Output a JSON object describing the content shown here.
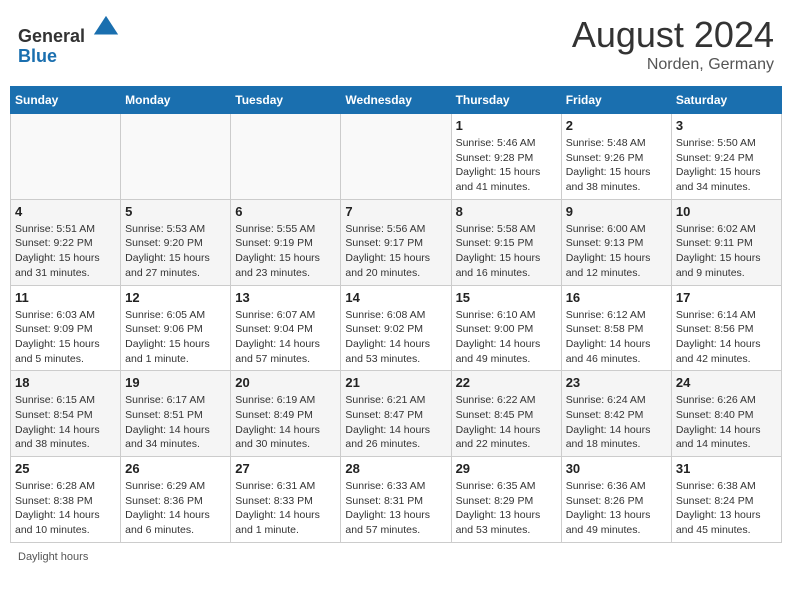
{
  "header": {
    "logo_line1": "General",
    "logo_line2": "Blue",
    "month_title": "August 2024",
    "location": "Norden, Germany"
  },
  "days_of_week": [
    "Sunday",
    "Monday",
    "Tuesday",
    "Wednesday",
    "Thursday",
    "Friday",
    "Saturday"
  ],
  "footer": {
    "note": "Daylight hours"
  },
  "weeks": [
    [
      {
        "day": "",
        "info": ""
      },
      {
        "day": "",
        "info": ""
      },
      {
        "day": "",
        "info": ""
      },
      {
        "day": "",
        "info": ""
      },
      {
        "day": "1",
        "info": "Sunrise: 5:46 AM\nSunset: 9:28 PM\nDaylight: 15 hours\nand 41 minutes."
      },
      {
        "day": "2",
        "info": "Sunrise: 5:48 AM\nSunset: 9:26 PM\nDaylight: 15 hours\nand 38 minutes."
      },
      {
        "day": "3",
        "info": "Sunrise: 5:50 AM\nSunset: 9:24 PM\nDaylight: 15 hours\nand 34 minutes."
      }
    ],
    [
      {
        "day": "4",
        "info": "Sunrise: 5:51 AM\nSunset: 9:22 PM\nDaylight: 15 hours\nand 31 minutes."
      },
      {
        "day": "5",
        "info": "Sunrise: 5:53 AM\nSunset: 9:20 PM\nDaylight: 15 hours\nand 27 minutes."
      },
      {
        "day": "6",
        "info": "Sunrise: 5:55 AM\nSunset: 9:19 PM\nDaylight: 15 hours\nand 23 minutes."
      },
      {
        "day": "7",
        "info": "Sunrise: 5:56 AM\nSunset: 9:17 PM\nDaylight: 15 hours\nand 20 minutes."
      },
      {
        "day": "8",
        "info": "Sunrise: 5:58 AM\nSunset: 9:15 PM\nDaylight: 15 hours\nand 16 minutes."
      },
      {
        "day": "9",
        "info": "Sunrise: 6:00 AM\nSunset: 9:13 PM\nDaylight: 15 hours\nand 12 minutes."
      },
      {
        "day": "10",
        "info": "Sunrise: 6:02 AM\nSunset: 9:11 PM\nDaylight: 15 hours\nand 9 minutes."
      }
    ],
    [
      {
        "day": "11",
        "info": "Sunrise: 6:03 AM\nSunset: 9:09 PM\nDaylight: 15 hours\nand 5 minutes."
      },
      {
        "day": "12",
        "info": "Sunrise: 6:05 AM\nSunset: 9:06 PM\nDaylight: 15 hours\nand 1 minute."
      },
      {
        "day": "13",
        "info": "Sunrise: 6:07 AM\nSunset: 9:04 PM\nDaylight: 14 hours\nand 57 minutes."
      },
      {
        "day": "14",
        "info": "Sunrise: 6:08 AM\nSunset: 9:02 PM\nDaylight: 14 hours\nand 53 minutes."
      },
      {
        "day": "15",
        "info": "Sunrise: 6:10 AM\nSunset: 9:00 PM\nDaylight: 14 hours\nand 49 minutes."
      },
      {
        "day": "16",
        "info": "Sunrise: 6:12 AM\nSunset: 8:58 PM\nDaylight: 14 hours\nand 46 minutes."
      },
      {
        "day": "17",
        "info": "Sunrise: 6:14 AM\nSunset: 8:56 PM\nDaylight: 14 hours\nand 42 minutes."
      }
    ],
    [
      {
        "day": "18",
        "info": "Sunrise: 6:15 AM\nSunset: 8:54 PM\nDaylight: 14 hours\nand 38 minutes."
      },
      {
        "day": "19",
        "info": "Sunrise: 6:17 AM\nSunset: 8:51 PM\nDaylight: 14 hours\nand 34 minutes."
      },
      {
        "day": "20",
        "info": "Sunrise: 6:19 AM\nSunset: 8:49 PM\nDaylight: 14 hours\nand 30 minutes."
      },
      {
        "day": "21",
        "info": "Sunrise: 6:21 AM\nSunset: 8:47 PM\nDaylight: 14 hours\nand 26 minutes."
      },
      {
        "day": "22",
        "info": "Sunrise: 6:22 AM\nSunset: 8:45 PM\nDaylight: 14 hours\nand 22 minutes."
      },
      {
        "day": "23",
        "info": "Sunrise: 6:24 AM\nSunset: 8:42 PM\nDaylight: 14 hours\nand 18 minutes."
      },
      {
        "day": "24",
        "info": "Sunrise: 6:26 AM\nSunset: 8:40 PM\nDaylight: 14 hours\nand 14 minutes."
      }
    ],
    [
      {
        "day": "25",
        "info": "Sunrise: 6:28 AM\nSunset: 8:38 PM\nDaylight: 14 hours\nand 10 minutes."
      },
      {
        "day": "26",
        "info": "Sunrise: 6:29 AM\nSunset: 8:36 PM\nDaylight: 14 hours\nand 6 minutes."
      },
      {
        "day": "27",
        "info": "Sunrise: 6:31 AM\nSunset: 8:33 PM\nDaylight: 14 hours\nand 1 minute."
      },
      {
        "day": "28",
        "info": "Sunrise: 6:33 AM\nSunset: 8:31 PM\nDaylight: 13 hours\nand 57 minutes."
      },
      {
        "day": "29",
        "info": "Sunrise: 6:35 AM\nSunset: 8:29 PM\nDaylight: 13 hours\nand 53 minutes."
      },
      {
        "day": "30",
        "info": "Sunrise: 6:36 AM\nSunset: 8:26 PM\nDaylight: 13 hours\nand 49 minutes."
      },
      {
        "day": "31",
        "info": "Sunrise: 6:38 AM\nSunset: 8:24 PM\nDaylight: 13 hours\nand 45 minutes."
      }
    ]
  ]
}
